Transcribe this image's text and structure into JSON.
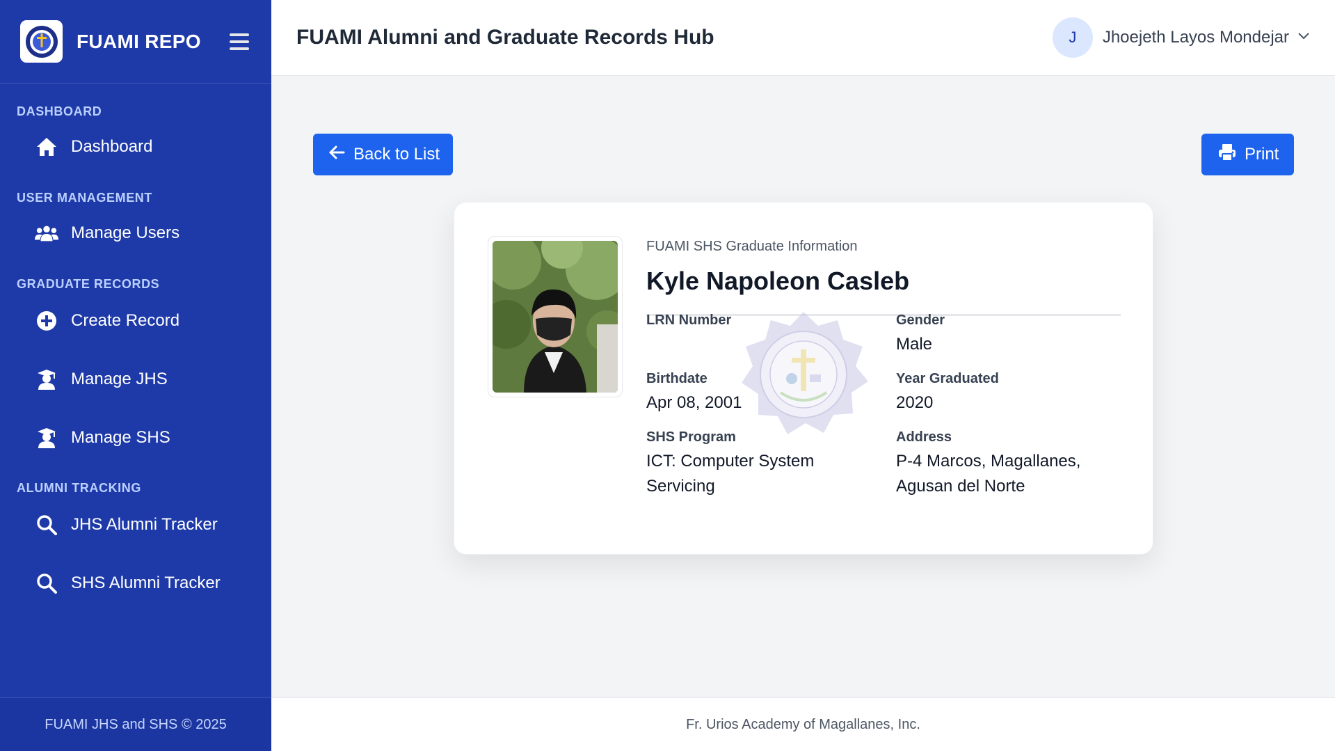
{
  "sidebar": {
    "brand": "FUAMI REPO",
    "sections": [
      {
        "title": "DASHBOARD",
        "items": [
          {
            "label": "Dashboard",
            "icon": "home-icon"
          }
        ]
      },
      {
        "title": "USER MANAGEMENT",
        "items": [
          {
            "label": "Manage Users",
            "icon": "users-icon"
          }
        ]
      },
      {
        "title": "GRADUATE RECORDS",
        "items": [
          {
            "label": "Create Record",
            "icon": "plus-circle-icon"
          },
          {
            "label": "Manage JHS",
            "icon": "graduate-icon"
          },
          {
            "label": "Manage SHS",
            "icon": "graduate-icon"
          }
        ]
      },
      {
        "title": "ALUMNI TRACKING",
        "items": [
          {
            "label": "JHS Alumni Tracker",
            "icon": "search-icon"
          },
          {
            "label": "SHS Alumni Tracker",
            "icon": "search-icon"
          }
        ]
      }
    ],
    "footer": "FUAMI JHS and SHS © 2025"
  },
  "header": {
    "title": "FUAMI Alumni and Graduate Records Hub",
    "user_initial": "J",
    "user_name": "Jhoejeth Layos Mondejar"
  },
  "actions": {
    "back_label": "Back to List",
    "print_label": "Print"
  },
  "record": {
    "subtitle": "FUAMI SHS Graduate Information",
    "name": "Kyle Napoleon Casleb",
    "fields": {
      "lrn_label": "LRN Number",
      "lrn_value": "",
      "gender_label": "Gender",
      "gender_value": "Male",
      "birthdate_label": "Birthdate",
      "birthdate_value": "Apr 08, 2001",
      "year_label": "Year Graduated",
      "year_value": "2020",
      "program_label": "SHS Program",
      "program_value": "ICT: Computer System Servicing",
      "address_label": "Address",
      "address_value": "P-4 Marcos, Magallanes, Agusan del Norte"
    },
    "seal_text": "FR. URIOS ACADEMY OF MAGALLANES, INC."
  },
  "footer": {
    "text": "Fr. Urios Academy of Magallanes, Inc."
  },
  "colors": {
    "sidebar": "#1e3aa8",
    "primary_button": "#1d63ed",
    "section_title": "#bcd0ff"
  }
}
